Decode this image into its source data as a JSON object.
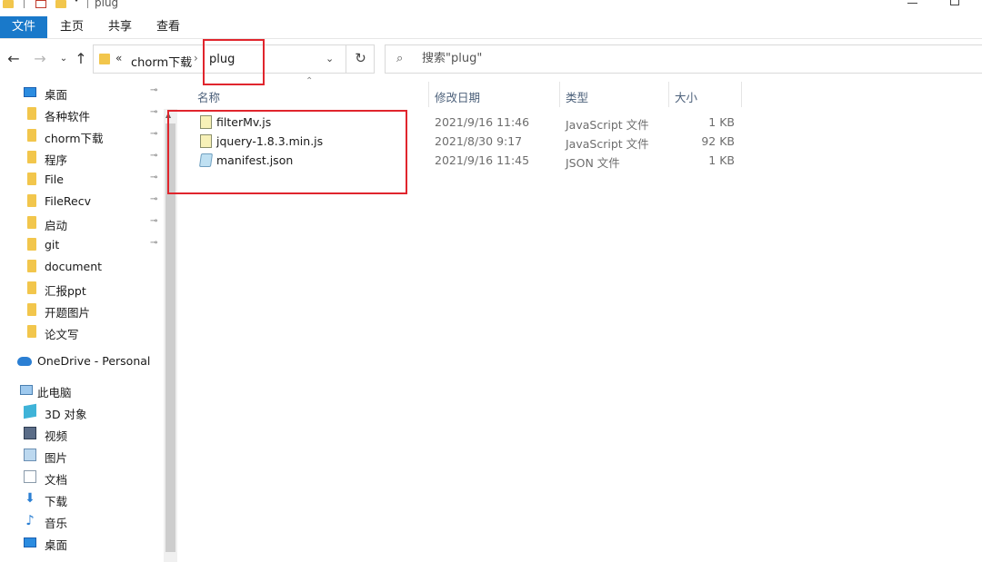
{
  "window": {
    "title": "plug"
  },
  "ribbon": {
    "tabs": [
      "文件",
      "主页",
      "共享",
      "查看"
    ]
  },
  "address": {
    "overflow_chevron": "«",
    "crumbs": [
      "chorm下载",
      "plug"
    ],
    "separator": "›",
    "dropdown_glyph": "⌄",
    "refresh_glyph": "↻"
  },
  "search": {
    "placeholder": "搜索\"plug\"",
    "icon_glyph": "⌕"
  },
  "columns": {
    "name": "名称",
    "date": "修改日期",
    "type": "类型",
    "size": "大小"
  },
  "files": [
    {
      "name": "filterMv.js",
      "date": "2021/9/16 11:46",
      "type": "JavaScript 文件",
      "size": "1 KB",
      "icon": "js-file-icon"
    },
    {
      "name": "jquery-1.8.3.min.js",
      "date": "2021/8/30 9:17",
      "type": "JavaScript 文件",
      "size": "92 KB",
      "icon": "js-file-icon"
    },
    {
      "name": "manifest.json",
      "date": "2021/9/16 11:45",
      "type": "JSON 文件",
      "size": "1 KB",
      "icon": "json-file-icon"
    }
  ],
  "nav": {
    "quick_access": [
      {
        "label": "桌面",
        "icon": "desktop-icon",
        "pinned": true
      },
      {
        "label": "各种软件",
        "icon": "folder-icon",
        "pinned": true
      },
      {
        "label": "chorm下载",
        "icon": "folder-icon",
        "pinned": true
      },
      {
        "label": "程序",
        "icon": "folder-icon",
        "pinned": true
      },
      {
        "label": "File",
        "icon": "folder-icon",
        "pinned": true
      },
      {
        "label": "FileRecv",
        "icon": "folder-icon",
        "pinned": true
      },
      {
        "label": "启动",
        "icon": "folder-icon",
        "pinned": true
      },
      {
        "label": "git",
        "icon": "folder-icon",
        "pinned": true
      },
      {
        "label": "document",
        "icon": "folder-icon",
        "pinned": false
      },
      {
        "label": "汇报ppt",
        "icon": "folder-icon",
        "pinned": false
      },
      {
        "label": "开题图片",
        "icon": "folder-icon",
        "pinned": false
      },
      {
        "label": "论文写",
        "icon": "folder-icon",
        "pinned": false
      }
    ],
    "onedrive": "OneDrive - Personal",
    "this_pc": "此电脑",
    "pc_items": [
      {
        "label": "3D 对象",
        "icon": "3d-objects-icon"
      },
      {
        "label": "视频",
        "icon": "video-icon"
      },
      {
        "label": "图片",
        "icon": "pictures-icon"
      },
      {
        "label": "文档",
        "icon": "documents-icon"
      },
      {
        "label": "下载",
        "icon": "download-icon"
      },
      {
        "label": "音乐",
        "icon": "music-icon"
      },
      {
        "label": "桌面",
        "icon": "desktop-icon"
      }
    ],
    "pin_glyph": "📌"
  },
  "colors": {
    "file_tab": "#1979ca",
    "folder": "#f2c64c",
    "annotation": "#e0252d",
    "header_text": "#4c607a"
  }
}
